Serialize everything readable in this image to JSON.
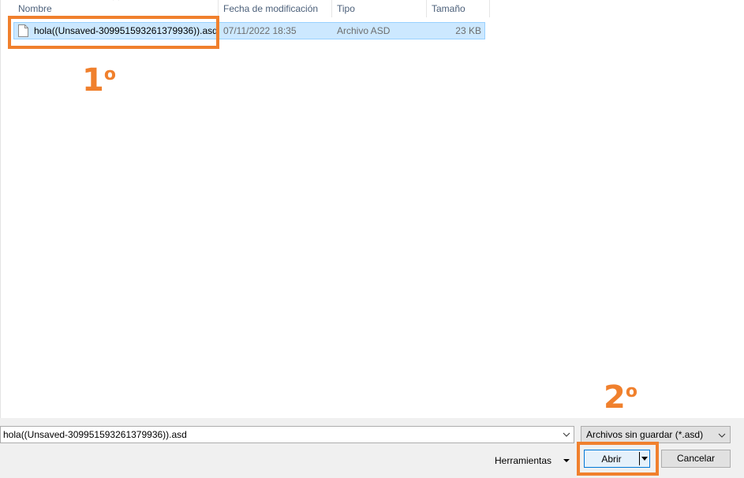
{
  "columns": {
    "name": "Nombre",
    "modified": "Fecha de modificación",
    "type": "Tipo",
    "size": "Tamaño"
  },
  "files": [
    {
      "name": "hola((Unsaved-309951593261379936)).asd",
      "modified": "07/11/2022 18:35",
      "type": "Archivo ASD",
      "size": "23 KB",
      "selected": true
    }
  ],
  "annotations": {
    "step1": "1",
    "step1_suffix": "o",
    "step2": "2",
    "step2_suffix": "o",
    "color": "#f0802d"
  },
  "bottom": {
    "filename_value": "hola((Unsaved-309951593261379936)).asd",
    "filter_selected": "Archivos sin guardar (*.asd)",
    "tools_label": "Herramientas",
    "open_label": "Abrir",
    "cancel_label": "Cancelar"
  },
  "colors": {
    "selection": "#cce8ff",
    "selection_border": "#99d1ff",
    "accent": "#0078d7",
    "header_text": "#4c607a"
  }
}
